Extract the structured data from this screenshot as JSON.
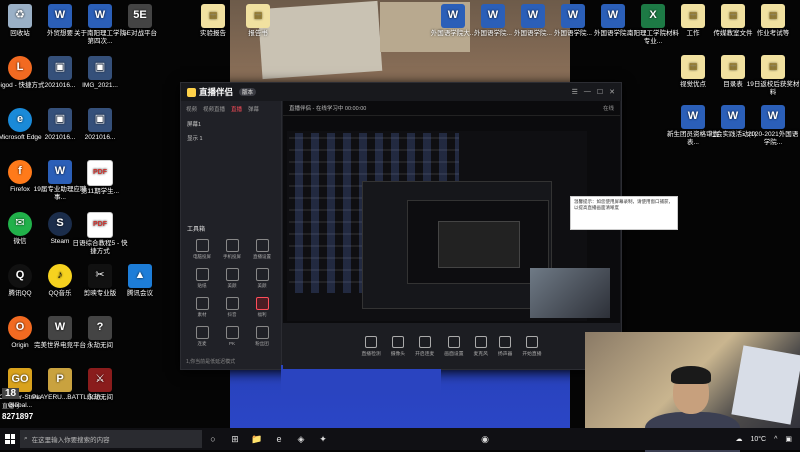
{
  "desktop_left": [
    {
      "label": "回收站",
      "kind": "recycle",
      "glyph": "♻"
    },
    {
      "label": "外贸想要",
      "kind": "word",
      "glyph": "W"
    },
    {
      "label": "关于南阳理工学院第四次...",
      "kind": "word",
      "glyph": "W"
    },
    {
      "label": "5E对战平台",
      "kind": "app",
      "glyph": "5E"
    },
    {
      "label": "leigod - 快捷方式",
      "kind": "origin",
      "glyph": "L"
    },
    {
      "label": "2021016...",
      "kind": "photo",
      "glyph": "▣"
    },
    {
      "label": "IMG_2021...",
      "kind": "photo",
      "glyph": "▣"
    },
    {
      "label": "Microsoft Edge",
      "kind": "edge",
      "glyph": "e"
    },
    {
      "label": "2021016...",
      "kind": "photo",
      "glyph": "▣"
    },
    {
      "label": "2021016...",
      "kind": "photo",
      "glyph": "▣"
    },
    {
      "label": "Firefox",
      "kind": "firefox",
      "glyph": "f"
    },
    {
      "label": "19届专业助理应聘事...",
      "kind": "word",
      "glyph": "W"
    },
    {
      "label": "第11期学生...",
      "kind": "pdf",
      "glyph": "PDF"
    },
    {
      "label": "微信",
      "kind": "wechat",
      "glyph": "✉"
    },
    {
      "label": "Steam",
      "kind": "steam",
      "glyph": "S"
    },
    {
      "label": "日语综合教程5 - 快捷方式",
      "kind": "pdf",
      "glyph": "PDF"
    },
    {
      "label": "腾讯QQ",
      "kind": "qq",
      "glyph": "Q"
    },
    {
      "label": "QQ音乐",
      "kind": "qqmusic",
      "glyph": "♪"
    },
    {
      "label": "剪映专业版",
      "kind": "jy",
      "glyph": "✂"
    },
    {
      "label": "腾讯会议",
      "kind": "tencent",
      "glyph": "▲"
    },
    {
      "label": "Origin",
      "kind": "origin",
      "glyph": "O"
    },
    {
      "label": "完美世界电竞平台",
      "kind": "app",
      "glyph": "W"
    },
    {
      "label": "永劫无间",
      "kind": "app",
      "glyph": "?"
    },
    {
      "label": "Counter-Strike Global...",
      "kind": "cs",
      "glyph": "GO"
    },
    {
      "label": "PLAYERU...BATTLEGR...",
      "kind": "pubg",
      "glyph": "P"
    },
    {
      "label": "永劫无间",
      "kind": "game",
      "glyph": "⚔"
    }
  ],
  "desktop_top": [
    {
      "label": "实验报告",
      "kind": "file",
      "glyph": "▤"
    },
    {
      "label": "报告书",
      "kind": "file",
      "glyph": "▤"
    },
    {
      "label": "外国语学院大...",
      "kind": "word",
      "glyph": "W"
    },
    {
      "label": "外国语学院...",
      "kind": "word",
      "glyph": "W"
    },
    {
      "label": "外国语学院...",
      "kind": "word",
      "glyph": "W"
    },
    {
      "label": "外国语学院...",
      "kind": "word",
      "glyph": "W"
    },
    {
      "label": "外国语学院...",
      "kind": "word",
      "glyph": "W"
    },
    {
      "label": "南阳理工学院材料专业...",
      "kind": "excel",
      "glyph": "X"
    },
    {
      "label": "工作",
      "kind": "file",
      "glyph": "▤"
    },
    {
      "label": "传媒教室文件",
      "kind": "file",
      "glyph": "▤"
    },
    {
      "label": "作业考试等",
      "kind": "file",
      "glyph": "▤"
    }
  ],
  "desktop_right": [
    {
      "label": "视觉优点",
      "kind": "file",
      "glyph": "▤"
    },
    {
      "label": "目录表",
      "kind": "file",
      "glyph": "▤"
    },
    {
      "label": "19日返校后获奖材料",
      "kind": "file",
      "glyph": "▤"
    },
    {
      "label": "新生团员资格审查表...",
      "kind": "word",
      "glyph": "W"
    },
    {
      "label": "社会实践活动(1)",
      "kind": "word",
      "glyph": "W"
    },
    {
      "label": "2020-2021外国语学院...",
      "kind": "word",
      "glyph": "W"
    }
  ],
  "app": {
    "title": "直播伴侣",
    "badge": "版本",
    "window_controls": [
      "☰",
      "—",
      "☐",
      "✕"
    ],
    "left_tabs": [
      "视频",
      "视频直播",
      "直播",
      "弹幕"
    ],
    "left_rows": [
      "屏幕1",
      "显示 1"
    ],
    "tools_title": "工具箱",
    "tools": [
      "电脑投屏",
      "手机投屏",
      "直播设置",
      "贴纸",
      "美颜",
      "美颜",
      "素材",
      "抖音",
      "福利",
      "连麦",
      "PK",
      "粉丝团"
    ],
    "bottom_text": "1,你当前是低延迟模式",
    "preview_header": "直播伴侣 - 在线学习中 00:00:00",
    "preview_status": "在线",
    "toolbar_buttons": [
      "直播检测",
      "摄像头",
      "开启连麦",
      "画面设置",
      "麦克风",
      "扬声器",
      "开始直播"
    ],
    "tooltip": "温馨提示：如您使用屏幕录制，请使用窗口捕获，以提高直播画面清晰度"
  },
  "streamer": {
    "brand": "18",
    "id": "8271897",
    "label": "直播号"
  },
  "taskbar": {
    "search_placeholder": "在这里输入你要搜索的内容",
    "temperature": "10°C",
    "icons": [
      "○",
      "⊞",
      "📁",
      "e",
      "◈",
      "✦",
      "◉"
    ]
  }
}
